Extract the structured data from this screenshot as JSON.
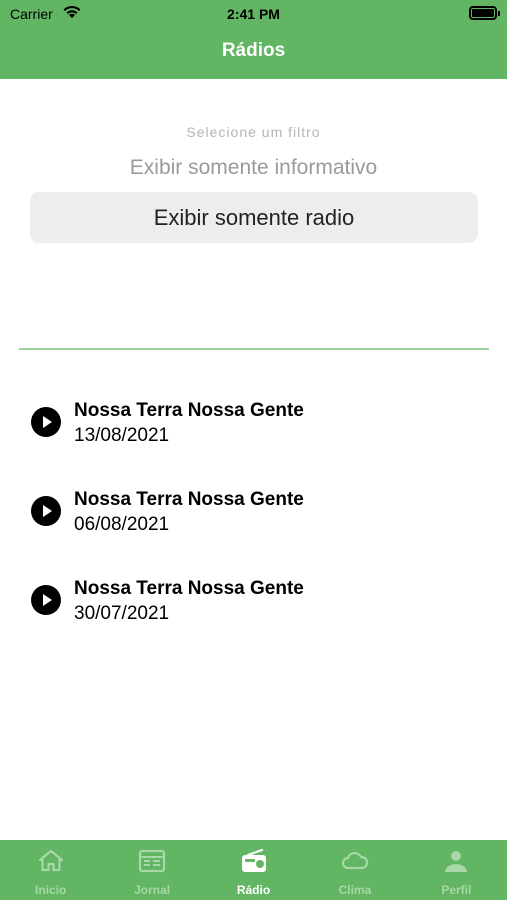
{
  "status_bar": {
    "carrier": "Carrier",
    "time": "2:41 PM"
  },
  "header": {
    "title": "Rádios"
  },
  "filter_picker": {
    "hint": "Selecione um filtro",
    "options": [
      "Exibir somente informativo",
      "Exibir somente radio"
    ],
    "selected": "Exibir somente radio"
  },
  "radio_list": [
    {
      "title": "Nossa Terra Nossa Gente",
      "date": "13/08/2021",
      "icon": "play-icon"
    },
    {
      "title": "Nossa Terra Nossa Gente",
      "date": "06/08/2021",
      "icon": "play-icon"
    },
    {
      "title": "Nossa Terra Nossa Gente",
      "date": "30/07/2021",
      "icon": "play-icon"
    }
  ],
  "tabbar": {
    "active": "Rádio",
    "tabs": [
      {
        "label": "Inicio",
        "icon": "home-icon"
      },
      {
        "label": "Jornal",
        "icon": "newspaper-icon"
      },
      {
        "label": "Rádio",
        "icon": "radio-icon"
      },
      {
        "label": "Clima",
        "icon": "cloud-icon"
      },
      {
        "label": "Perfil",
        "icon": "person-icon"
      }
    ]
  },
  "colors": {
    "brand_green": "#62b562",
    "divider_green": "#9ed29e",
    "tab_inactive": "#a8d8a8",
    "tab_active": "#ffffff"
  }
}
